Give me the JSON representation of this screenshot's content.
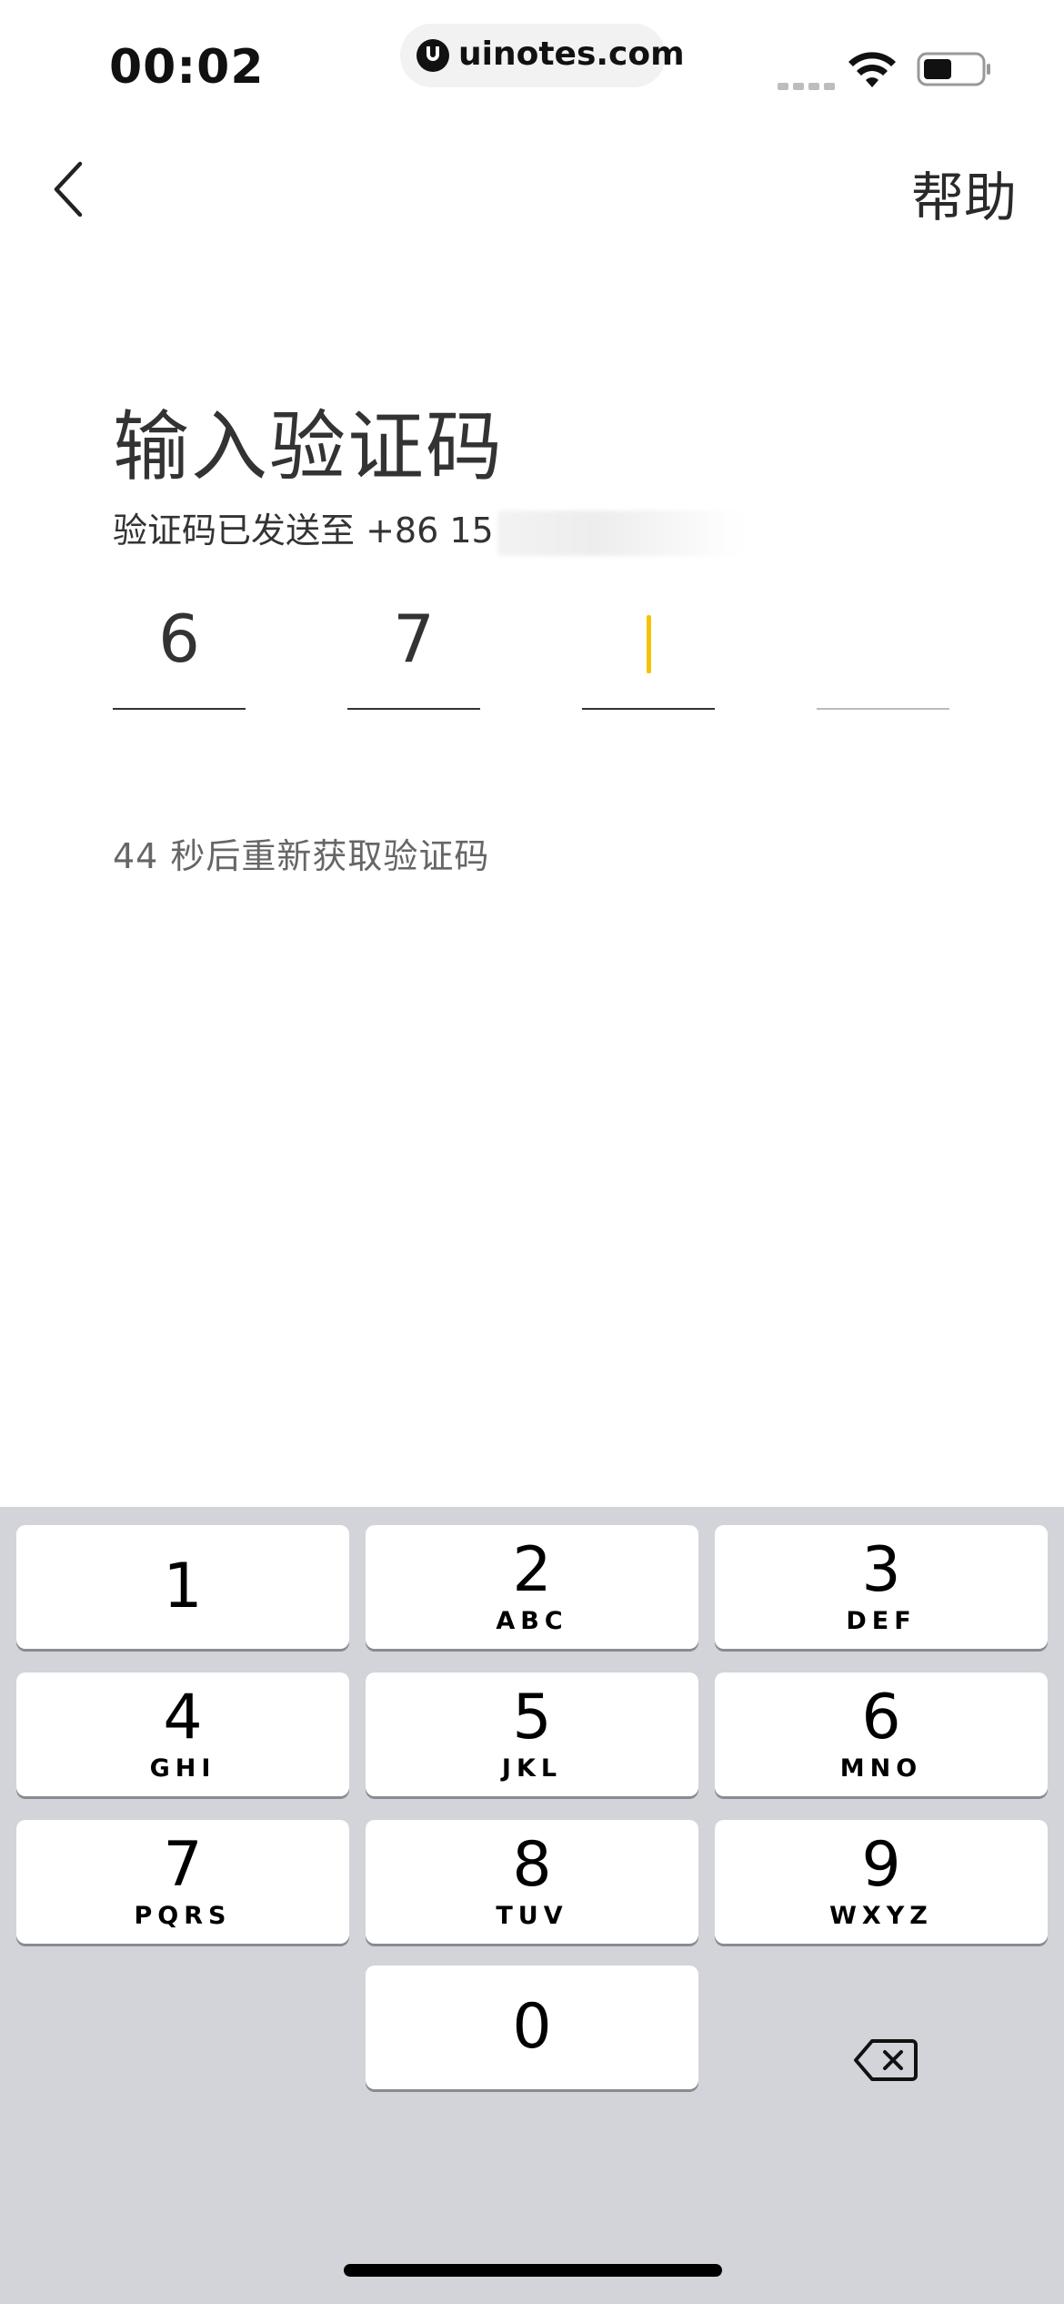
{
  "status_bar": {
    "time": "00:02",
    "url": "uinotes.com",
    "icons": [
      "signal-dots-icon",
      "wifi-icon",
      "battery-icon"
    ]
  },
  "nav": {
    "back_icon": "chevron-left-icon",
    "help_label": "帮助"
  },
  "title": "输入验证码",
  "sent_to": {
    "label": "验证码已发送至 +86 15"
  },
  "otp": {
    "digits": [
      "6",
      "7",
      "",
      ""
    ],
    "focused_index": 2,
    "cursor_color": "#f5c400"
  },
  "resend_text": "44 秒后重新获取验证码",
  "keyboard": {
    "keys": [
      {
        "digit": "1",
        "letters": ""
      },
      {
        "digit": "2",
        "letters": "ABC"
      },
      {
        "digit": "3",
        "letters": "DEF"
      },
      {
        "digit": "4",
        "letters": "GHI"
      },
      {
        "digit": "5",
        "letters": "JKL"
      },
      {
        "digit": "6",
        "letters": "MNO"
      },
      {
        "digit": "7",
        "letters": "PQRS"
      },
      {
        "digit": "8",
        "letters": "TUV"
      },
      {
        "digit": "9",
        "letters": "WXYZ"
      },
      {
        "digit": "0",
        "letters": ""
      }
    ],
    "delete_icon": "backspace-icon",
    "background": "#d2d4da"
  }
}
